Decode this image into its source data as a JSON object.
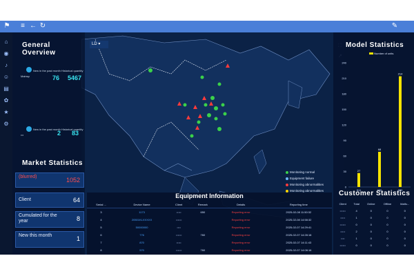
{
  "topbar": {
    "icons": [
      "flag-icon",
      "menu-icon",
      "back-arrow-icon",
      "refresh-icon",
      "edit-icon"
    ]
  },
  "left_rail": {
    "icons": [
      "home-icon",
      "location-icon",
      "bell-icon",
      "users-icon",
      "chart-icon",
      "settings-icon",
      "star-icon",
      "gear-icon"
    ]
  },
  "general_overview": {
    "title": "General Overview",
    "dropdown_value": "LD",
    "block1": {
      "label": "New in the past month Historical quantity",
      "sub_label": "Mainsp",
      "new_value": "76",
      "historical_value": "5467"
    },
    "block2": {
      "label": "New in the past month Historical quantity",
      "sub_label": "•••",
      "new_value": "2",
      "historical_value": "83"
    }
  },
  "market_statistics": {
    "title": "Market Statistics",
    "cards": [
      {
        "label": "(blurred)",
        "value": "1052",
        "alert": true
      },
      {
        "label": "Client",
        "value": "64",
        "alert": false
      },
      {
        "label": "Cumulated for the year",
        "value": "8",
        "alert": false
      },
      {
        "label": "New this month",
        "value": "1",
        "alert": false
      }
    ]
  },
  "map": {
    "legend": [
      {
        "label": "Monitoring normal",
        "color": "#3bd14a"
      },
      {
        "label": "Equipment failure",
        "color": "#6fb8ff"
      },
      {
        "label": "Monitoring abnormalities",
        "color": "#ff3b3b"
      },
      {
        "label": "Monitoring abnormalities",
        "color": "#ffd400"
      }
    ]
  },
  "equipment_information": {
    "title": "Equipment Information",
    "columns": [
      "Serial ...",
      "Device Name",
      "Client",
      "Remark",
      "Details",
      "Reporting time"
    ],
    "rows": [
      {
        "serial": "3",
        "device": "1173",
        "client": "•••••",
        "remark": "650",
        "details": "Reporting error",
        "time": "2025-02-08 11:50:32"
      },
      {
        "serial": "4",
        "device": "20501KLXXXXX",
        "client": "••••••",
        "remark": "",
        "details": "Reporting error",
        "time": "2025-02-08 14:58:32"
      },
      {
        "serial": "5",
        "device": "50000000",
        "client": "••••",
        "remark": "",
        "details": "Reporting error",
        "time": "2025-02-07 14:29:41"
      },
      {
        "serial": "6",
        "device": "776",
        "client": "••••••",
        "remark": "760",
        "details": "Reporting error",
        "time": "2025-02-07 14:28:18"
      },
      {
        "serial": "7",
        "device": "870",
        "client": "•••••",
        "remark": "",
        "details": "Reporting error",
        "time": "2025-02-07 14:11:43"
      },
      {
        "serial": "8",
        "device": "570",
        "client": "••••••",
        "remark": "760",
        "details": "Reporting error",
        "time": "2025-02-07 14:08:16"
      }
    ]
  },
  "model_statistics": {
    "title": "Model Statistics",
    "legend": "Number of units"
  },
  "chart_data": {
    "type": "bar",
    "categories": [
      "911",
      "950",
      "960"
    ],
    "values": [
      27,
      68,
      214
    ],
    "ylim": [
      0,
      240
    ],
    "yticks": [
      0,
      30,
      60,
      90,
      120,
      150,
      180,
      210,
      240
    ],
    "legend": "Number of units",
    "color": "#f5e300"
  },
  "customer_statistics": {
    "title": "Customer Statistics",
    "columns": [
      "Client",
      "Total",
      "Online",
      "Offline",
      "Malfu..."
    ],
    "rows": [
      [
        "••••••",
        "4",
        "0",
        "0",
        "0"
      ],
      [
        "•••••",
        "1",
        "0",
        "0",
        "0"
      ],
      [
        "••••••",
        "0",
        "0",
        "0",
        "0"
      ],
      [
        "•••••",
        "2",
        "0",
        "0",
        "0"
      ],
      [
        "••••",
        "1",
        "0",
        "0",
        "0"
      ],
      [
        "••••••",
        "0",
        "0",
        "0",
        "0"
      ]
    ]
  }
}
